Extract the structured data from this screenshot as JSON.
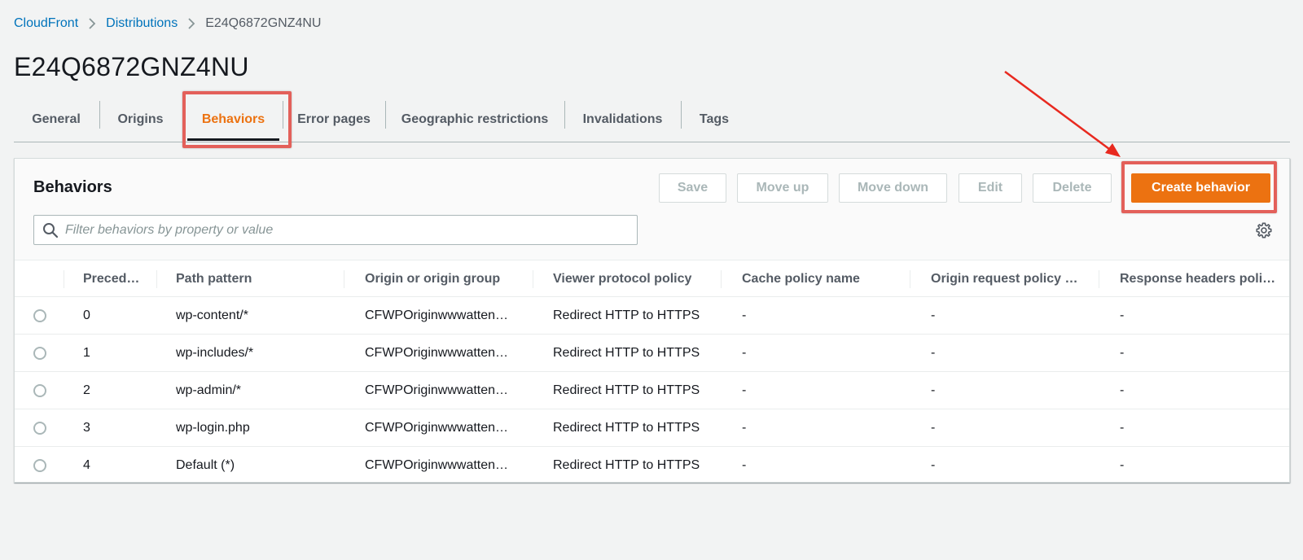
{
  "breadcrumb": {
    "items": [
      "CloudFront",
      "Distributions"
    ],
    "current": "E24Q6872GNZ4NU"
  },
  "page_title": "E24Q6872GNZ4NU",
  "tabs": [
    "General",
    "Origins",
    "Behaviors",
    "Error pages",
    "Geographic restrictions",
    "Invalidations",
    "Tags"
  ],
  "active_tab": "Behaviors",
  "panel": {
    "title": "Behaviors",
    "buttons": {
      "save": "Save",
      "move_up": "Move up",
      "move_down": "Move down",
      "edit": "Edit",
      "delete": "Delete",
      "create": "Create behavior"
    },
    "search_placeholder": "Filter behaviors by property or value"
  },
  "table": {
    "columns": [
      "Preced…",
      "Path pattern",
      "Origin or origin group",
      "Viewer protocol policy",
      "Cache policy name",
      "Origin request policy …",
      "Response headers poli…"
    ],
    "rows": [
      [
        "0",
        "wp-content/*",
        "CFWPOriginwwwatten…",
        "Redirect HTTP to HTTPS",
        "-",
        "-",
        "-"
      ],
      [
        "1",
        "wp-includes/*",
        "CFWPOriginwwwatten…",
        "Redirect HTTP to HTTPS",
        "-",
        "-",
        "-"
      ],
      [
        "2",
        "wp-admin/*",
        "CFWPOriginwwwatten…",
        "Redirect HTTP to HTTPS",
        "-",
        "-",
        "-"
      ],
      [
        "3",
        "wp-login.php",
        "CFWPOriginwwwatten…",
        "Redirect HTTP to HTTPS",
        "-",
        "-",
        "-"
      ],
      [
        "4",
        "Default (*)",
        "CFWPOriginwwwatten…",
        "Redirect HTTP to HTTPS",
        "-",
        "-",
        "-"
      ]
    ]
  },
  "colors": {
    "accent": "#ec7211",
    "link": "#0073bb",
    "annotation": "#e3605a"
  }
}
